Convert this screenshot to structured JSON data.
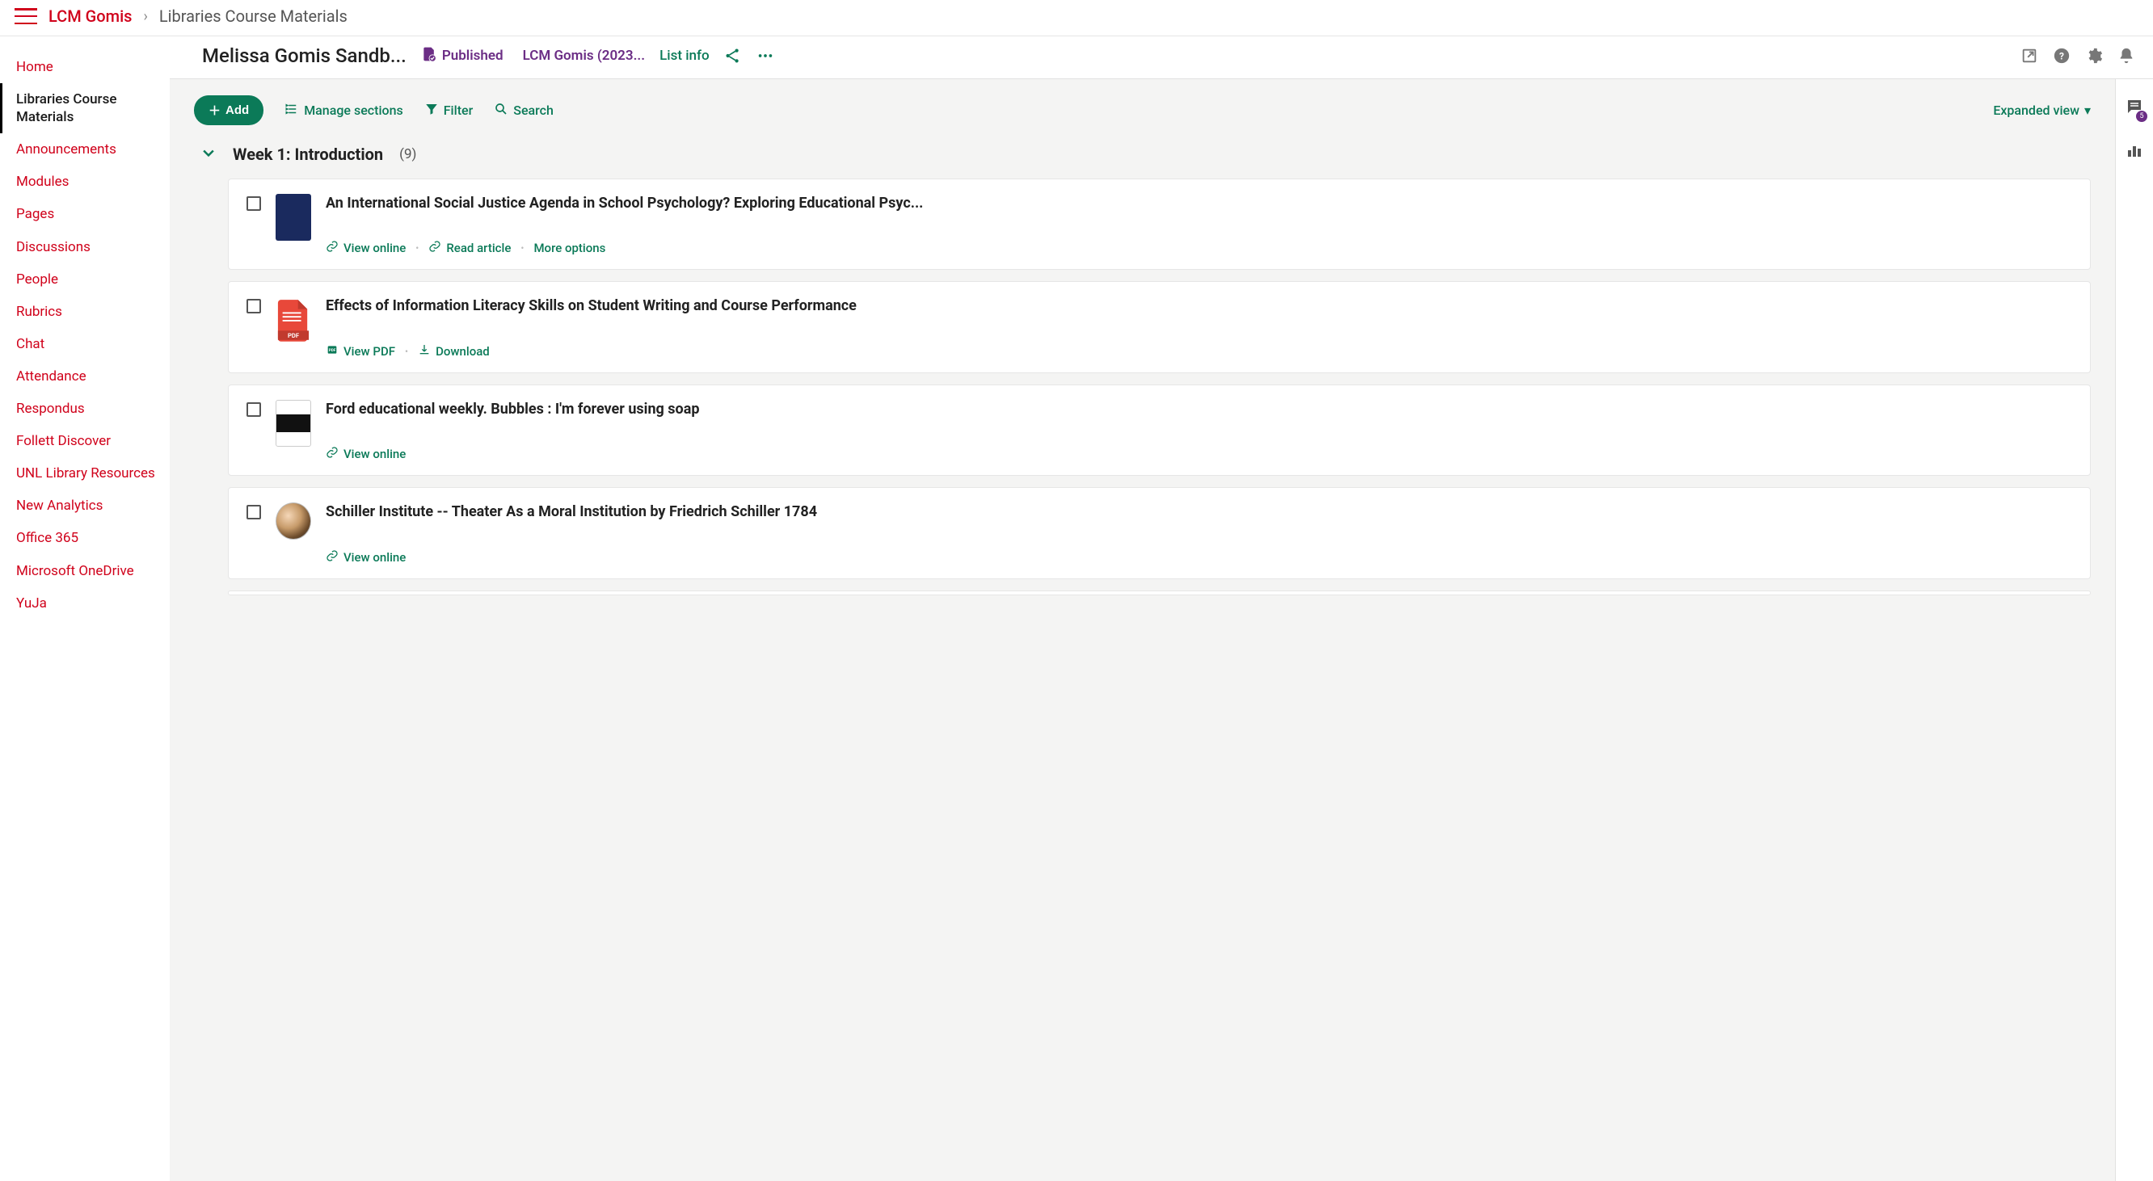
{
  "breadcrumb": {
    "root": "LCM Gomis",
    "page": "Libraries Course Materials"
  },
  "sidenav": {
    "items": [
      {
        "label": "Home",
        "active": false
      },
      {
        "label": "Libraries Course Materials",
        "active": true
      },
      {
        "label": "Announcements",
        "active": false
      },
      {
        "label": "Modules",
        "active": false
      },
      {
        "label": "Pages",
        "active": false
      },
      {
        "label": "Discussions",
        "active": false
      },
      {
        "label": "People",
        "active": false
      },
      {
        "label": "Rubrics",
        "active": false
      },
      {
        "label": "Chat",
        "active": false
      },
      {
        "label": "Attendance",
        "active": false
      },
      {
        "label": "Respondus",
        "active": false
      },
      {
        "label": "Follett Discover",
        "active": false
      },
      {
        "label": "UNL Library Resources",
        "active": false
      },
      {
        "label": "New Analytics",
        "active": false
      },
      {
        "label": "Office 365",
        "active": false
      },
      {
        "label": "Microsoft OneDrive",
        "active": false
      },
      {
        "label": "YuJa",
        "active": false
      }
    ]
  },
  "header": {
    "context_title": "Melissa Gomis Sandb...",
    "published_label": "Published",
    "course_label": "LCM Gomis (2023...",
    "listinfo_label": "List info"
  },
  "toolbar": {
    "add_label": "Add",
    "manage_label": "Manage sections",
    "filter_label": "Filter",
    "search_label": "Search",
    "view_label": "Expanded view"
  },
  "section": {
    "title": "Week 1: Introduction",
    "count": "(9)"
  },
  "items": [
    {
      "title": "An International Social Justice Agenda in School Psychology? Exploring Educational Psyc...",
      "thumb": "book",
      "actions": [
        {
          "icon": "link",
          "label": "View online"
        },
        {
          "icon": "link",
          "label": "Read article"
        },
        {
          "icon": "none",
          "label": "More options"
        }
      ]
    },
    {
      "title": "Effects of Information Literacy Skills on Student Writing and Course Performance",
      "thumb": "pdf",
      "actions": [
        {
          "icon": "pdf",
          "label": "View PDF"
        },
        {
          "icon": "download",
          "label": "Download"
        }
      ]
    },
    {
      "title": "Ford educational weekly. Bubbles : I'm forever using soap",
      "thumb": "film",
      "actions": [
        {
          "icon": "link",
          "label": "View online"
        }
      ]
    },
    {
      "title": "Schiller Institute -- Theater As a Moral Institution by Friedrich Schiller 1784",
      "thumb": "portrait",
      "actions": [
        {
          "icon": "link",
          "label": "View online"
        }
      ]
    }
  ],
  "right_rail": {
    "comment_badge": "5"
  }
}
